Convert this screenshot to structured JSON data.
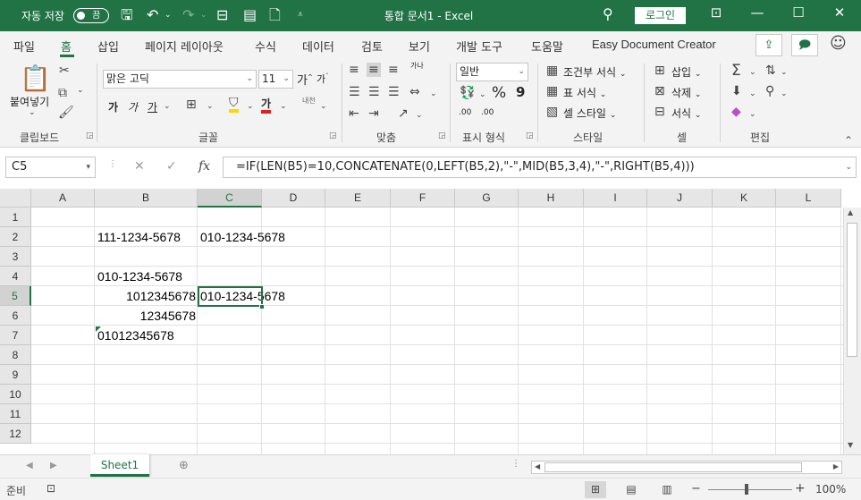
{
  "titlebar": {
    "autosave_label": "자동 저장",
    "autosave_state": "끔",
    "doc_title": "통합 문서1  -  Excel",
    "login_label": "로그인"
  },
  "tabs": [
    "파일",
    "홈",
    "삽입",
    "페이지 레이아웃",
    "수식",
    "데이터",
    "검토",
    "보기",
    "개발 도구",
    "도움말",
    "Easy Document Creator"
  ],
  "active_tab": "홈",
  "ribbon": {
    "clipboard": {
      "paste_label": "붙여넣기",
      "group_label": "클립보드"
    },
    "font": {
      "font_name": "맑은 고딕",
      "font_size": "11",
      "group_label": "글꼴",
      "bold": "가",
      "italic": "가",
      "underline": "가",
      "font_color_glyph": "가",
      "grow": "가",
      "shrink": "가",
      "phonetic": "내천"
    },
    "alignment": {
      "group_label": "맞춤",
      "wrap_glyph": "가나"
    },
    "number": {
      "format": "일반",
      "group_label": "표시 형식",
      "percent": "%",
      "comma": "9",
      "inc_decimal": ".00",
      "dec_decimal": ".00"
    },
    "styles": {
      "conditional_label": "조건부 서식",
      "table_label": "표 서식",
      "cell_style_label": "셀 스타일",
      "group_label": "스타일"
    },
    "cells": {
      "insert_label": "삽입",
      "delete_label": "삭제",
      "format_label": "서식",
      "group_label": "셀"
    },
    "editing": {
      "group_label": "편집"
    }
  },
  "formula_bar": {
    "name_box": "C5",
    "formula": "=IF(LEN(B5)=10,CONCATENATE(0,LEFT(B5,2),\"-\",MID(B5,3,4),\"-\",RIGHT(B5,4)))"
  },
  "grid": {
    "columns": [
      "A",
      "B",
      "C",
      "D",
      "E",
      "F",
      "G",
      "H",
      "I",
      "J",
      "K",
      "L"
    ],
    "rows": [
      "1",
      "2",
      "3",
      "4",
      "5",
      "6",
      "7",
      "8",
      "9",
      "10",
      "11",
      "12"
    ],
    "selected_cell": "C5",
    "cells": {
      "B2": "111-1234-5678",
      "C2": "010-1234-5678",
      "B4": "010-1234-5678",
      "B5": "1012345678",
      "C5": "010-1234-5678",
      "B6": "12345678",
      "B7": "01012345678"
    }
  },
  "sheets": [
    "Sheet1"
  ],
  "active_sheet": "Sheet1",
  "status": {
    "ready": "준비",
    "zoom": "100%"
  },
  "colors": {
    "accent": "#217346"
  }
}
